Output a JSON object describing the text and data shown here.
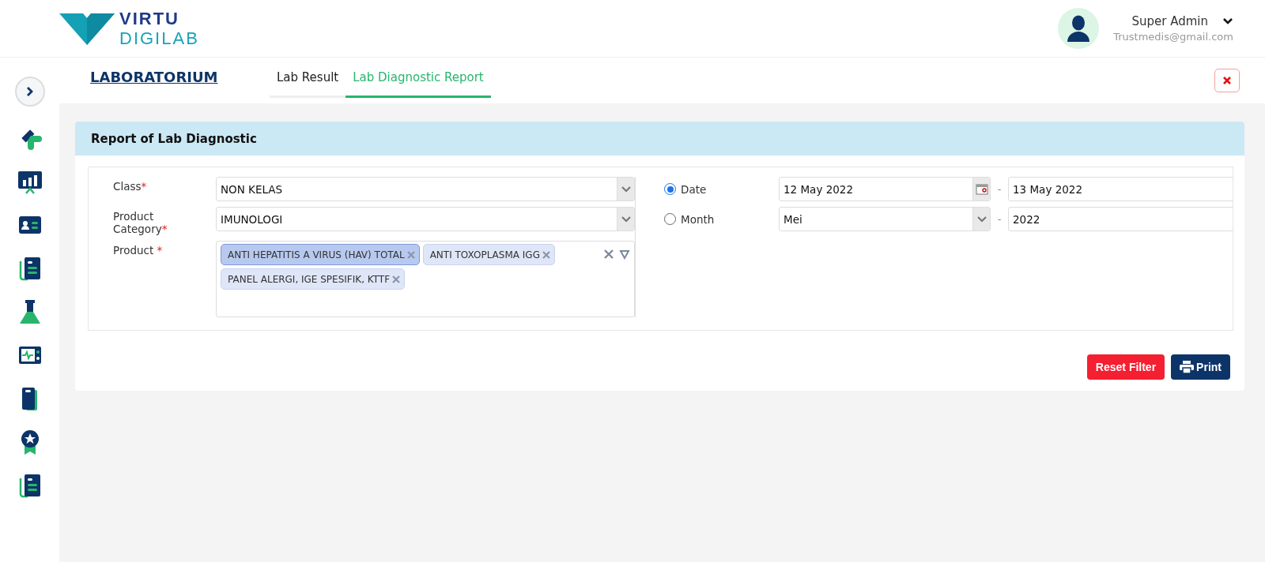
{
  "logo": {
    "line1": "VIRTU",
    "line2": "DIGILAB"
  },
  "user": {
    "name": "Super Admin",
    "email": "Trustmedis@gmail.com"
  },
  "module": {
    "title": "LABORATORIUM"
  },
  "tabs": [
    {
      "label": "Lab Result",
      "selected": false
    },
    {
      "label": "Lab Diagnostic Report",
      "selected": true
    }
  ],
  "card": {
    "title": "Report of Lab Diagnostic"
  },
  "filters": {
    "class": {
      "label": "Class",
      "required_mark": "*",
      "value": "NON KELAS"
    },
    "category": {
      "label": "Product Category",
      "required_mark": "*",
      "value": "IMUNOLOGI"
    },
    "product": {
      "label": "Product",
      "required_mark": "*",
      "chips": [
        {
          "label": "ANTI HEPATITIS A VIRUS (HAV) TOTAL",
          "selected": true
        },
        {
          "label": "ANTI TOXOPLASMA IGG",
          "selected": false
        },
        {
          "label": "PANEL ALERGI, IGE SPESIFIK, KTTF",
          "selected": false
        }
      ]
    }
  },
  "period": [
    {
      "label": "Date",
      "selected": true,
      "kind": "date",
      "from": "12 May 2022",
      "separator": "-",
      "to": "13 May 2022"
    },
    {
      "label": "Month",
      "selected": false,
      "kind": "month",
      "from": "Mei",
      "separator": "-",
      "to": "2022"
    }
  ],
  "buttons": [
    {
      "label": "Reset Filter",
      "kind": "danger"
    },
    {
      "label": "Print",
      "kind": "print"
    }
  ]
}
